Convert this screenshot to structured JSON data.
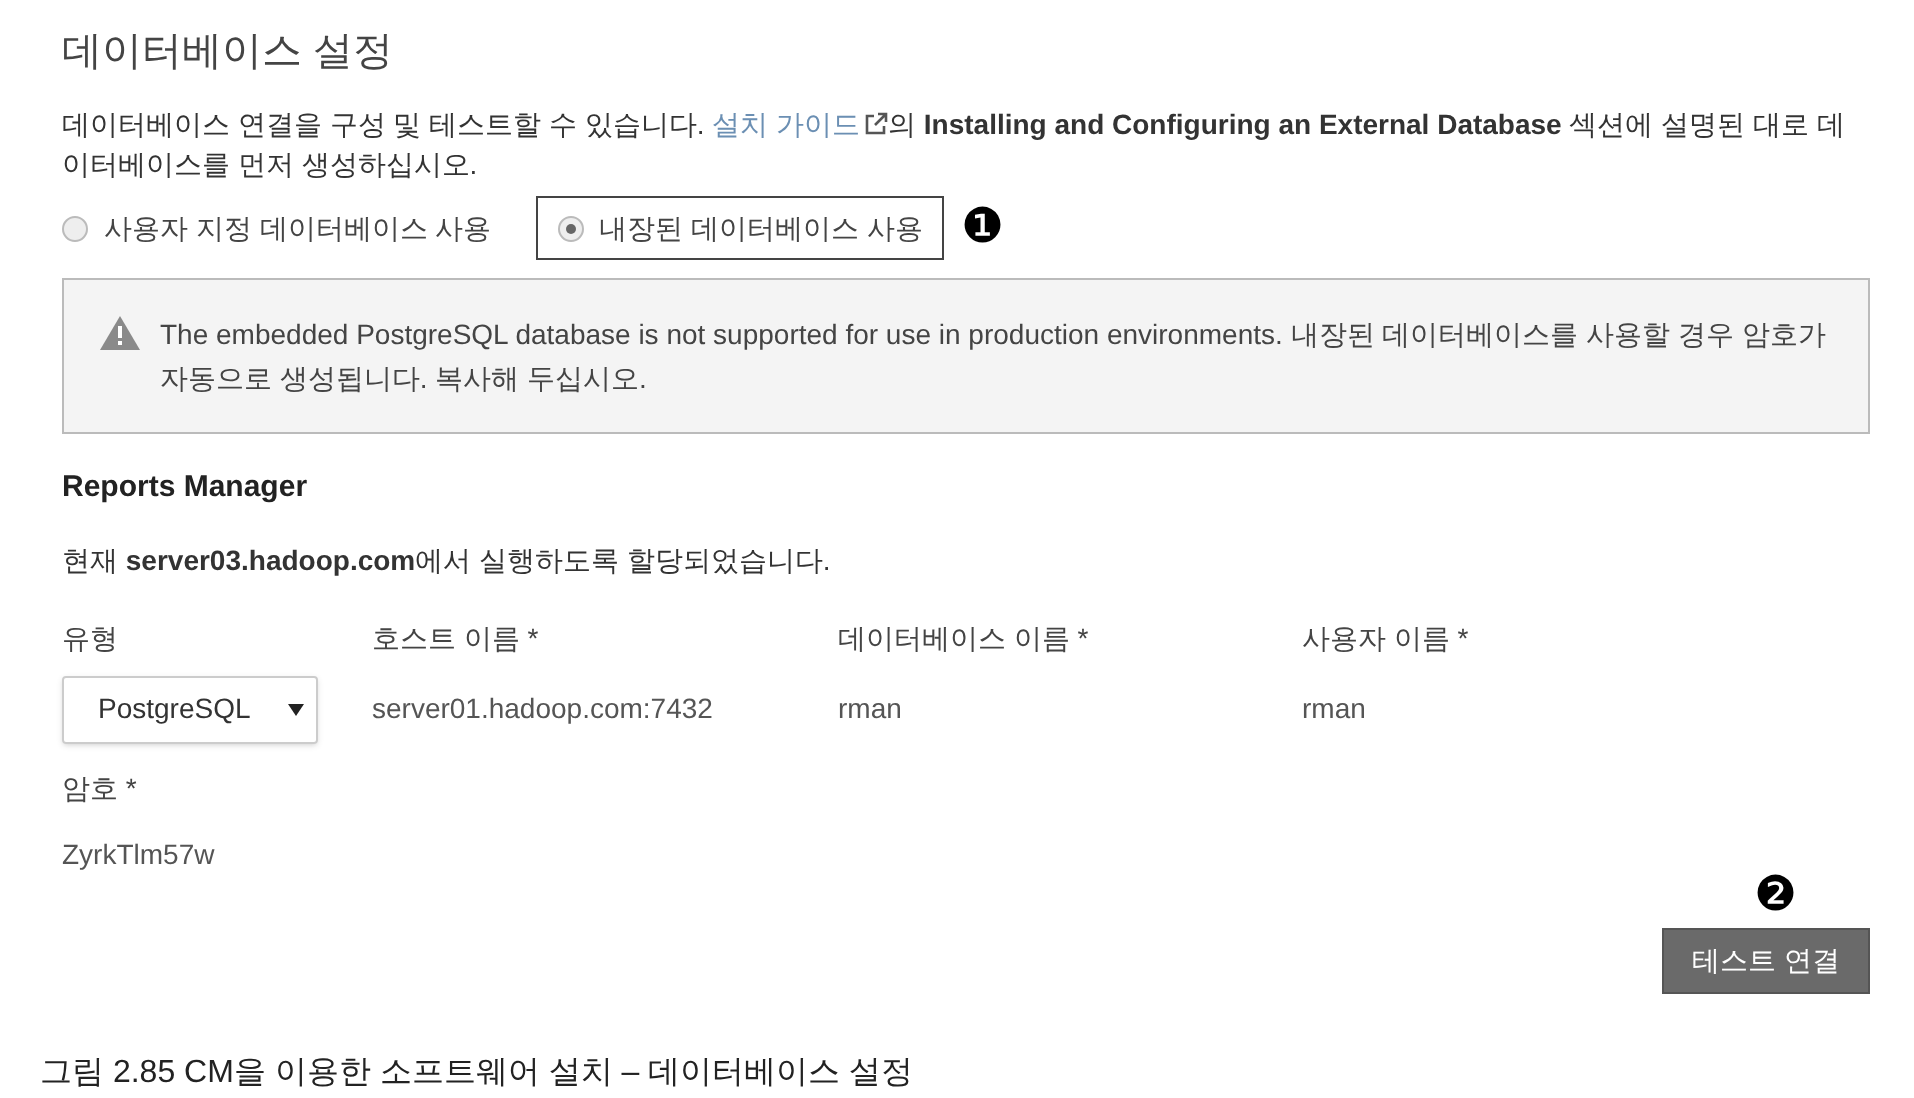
{
  "title": "데이터베이스 설정",
  "description": {
    "before": "데이터베이스 연결을 구성 및 테스트할 수 있습니다. ",
    "link": "설치 가이드",
    "after": "의 **Installing and Configuring an External Database** 섹션에 설명된 대로 데이터베이스를 먼저 생성하십시오."
  },
  "db_options": [
    {
      "label": "사용자 지정 데이터베이스 사용",
      "selected": false
    },
    {
      "label": "내장된 데이터베이스 사용",
      "selected": true
    }
  ],
  "callouts": [
    "❶",
    "❷"
  ],
  "warning": "The embedded PostgreSQL database is not supported for use in production environments. 내장된 데이터베이스를 사용할 경우 암호가 자동으로 생성됩니다. 복사해 두십시오.",
  "section": {
    "title": "Reports Manager",
    "note": "현재 **server03.hadoop.com**에서 실행하도록 할당되었습니다."
  },
  "fields": [
    {
      "kind": "select",
      "label": "유형",
      "value": "PostgreSQL"
    },
    {
      "kind": "text",
      "label": "호스트 이름 *",
      "value": "server01.hadoop.com:7432"
    },
    {
      "kind": "text",
      "label": "데이터베이스 이름 *",
      "value": "rman"
    },
    {
      "kind": "text",
      "label": "사용자 이름 *",
      "value": "rman"
    }
  ],
  "password": {
    "label": "암호 *",
    "value": "ZyrkTlm57w"
  },
  "test_button": "테스트 연결",
  "caption": "그림 2.85 CM을 이용한 소프트웨어 설치 – 데이터베이스 설정"
}
